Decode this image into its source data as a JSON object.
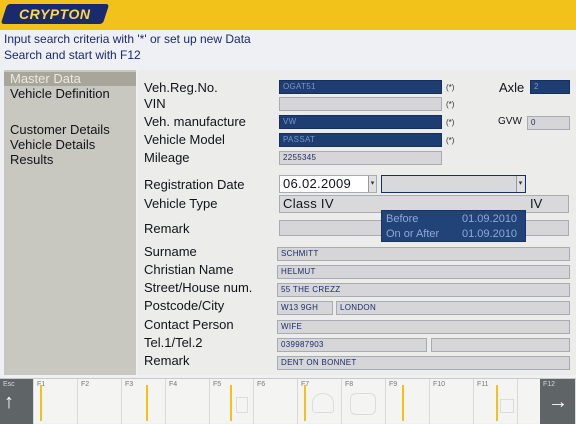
{
  "app": {
    "logo_text": "CRYPTON"
  },
  "instructions": {
    "line1": "Input search criteria with '*' or set up new Data",
    "line2": "Search and start with F12"
  },
  "sidebar": {
    "items": [
      {
        "label": "Master Data",
        "active": true
      },
      {
        "label": "Vehicle Definition",
        "active": false
      },
      {
        "label": "Customer Details",
        "active": false
      },
      {
        "label": "Vehicle Details",
        "active": false
      },
      {
        "label": "Results",
        "active": false
      }
    ]
  },
  "vehicle": {
    "reg_no_label": "Veh.Reg.No.",
    "reg_no_value": "OGAT51",
    "vin_label": "VIN",
    "vin_value": "",
    "manufacturer_label": "Veh. manufacture",
    "manufacturer_value": "VW",
    "model_label": "Vehicle Model",
    "model_value": "PASSAT",
    "mileage_label": "Mileage",
    "mileage_value": "2255345",
    "required_marker": "(*)",
    "axle_label": "Axle",
    "axle_value": "2",
    "gvw_label": "GVW",
    "gvw_value": "0",
    "reg_date_label": "Registration Date",
    "reg_date_value": "06.02.2009",
    "vehicle_type_label": "Vehicle Type",
    "vehicle_type_value": "Class IV",
    "vehicle_type_suffix": "IV",
    "remark_label": "Remark",
    "remark_value": "",
    "combo_arrow": "▾",
    "date_filter_options": [
      {
        "label": "Before",
        "date": "01.09.2010"
      },
      {
        "label": "On or After",
        "date": "01.09.2010"
      }
    ]
  },
  "customer": {
    "surname_label": "Surname",
    "surname_value": "SCHMITT",
    "christian_name_label": "Christian Name",
    "christian_name_value": "HELMUT",
    "street_label": "Street/House num.",
    "street_value": "55 THE CREZZ",
    "postcode_label": "Postcode/City",
    "postcode_value": "W13 9GH",
    "city_value": "LONDON",
    "contact_label": "Contact Person",
    "contact_value": "WIFE",
    "tel_label": "Tel.1/Tel.2",
    "tel1_value": "039987903",
    "tel2_value": "",
    "remark_label": "Remark",
    "remark_value": "DENT ON BONNET"
  },
  "function_keys": [
    {
      "key": "Esc",
      "icon": "arrow-up-icon"
    },
    {
      "key": "F1"
    },
    {
      "key": "F2"
    },
    {
      "key": "F3"
    },
    {
      "key": "F4"
    },
    {
      "key": "F5"
    },
    {
      "key": "F6"
    },
    {
      "key": "F7"
    },
    {
      "key": "F8"
    },
    {
      "key": "F9"
    },
    {
      "key": "F10"
    },
    {
      "key": "F11"
    },
    {
      "key": "F12",
      "icon": "arrow-right-icon"
    }
  ],
  "colors": {
    "brand_yellow": "#f2c21a",
    "required_field_blue": "#1e3e72",
    "instruction_blue": "#1b2a6b"
  }
}
